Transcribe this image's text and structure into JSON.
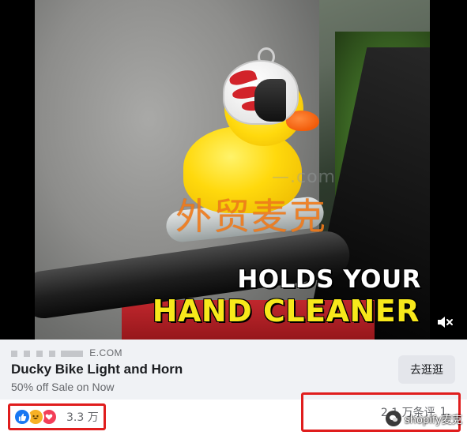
{
  "video": {
    "overlay_line1": "HOLDS YOUR",
    "overlay_line2": "HAND CLEANER",
    "watermark": "外贸麦克",
    "faint_watermark": "—.com",
    "mute_icon": "speaker-muted-icon",
    "overlay_colors": {
      "line1": "#ffffff",
      "line2": "#f7e81b",
      "watermark": "#f07a1a"
    }
  },
  "link_card": {
    "domain": "E.COM",
    "title": "Ducky Bike Light and Horn",
    "subtitle": "50% off Sale on Now",
    "cta_label": "去逛逛"
  },
  "reactions": {
    "icons": [
      "like-icon",
      "haha-icon",
      "love-icon"
    ],
    "count": "3.3 万",
    "colors": {
      "like": "#1877f2",
      "haha": "#f7b125",
      "love": "#f33e58"
    }
  },
  "stats": {
    "comments": "2.1 万条评",
    "shares": "1.",
    "badge": "shopify麦克"
  },
  "highlight_color": "#e01d1d"
}
